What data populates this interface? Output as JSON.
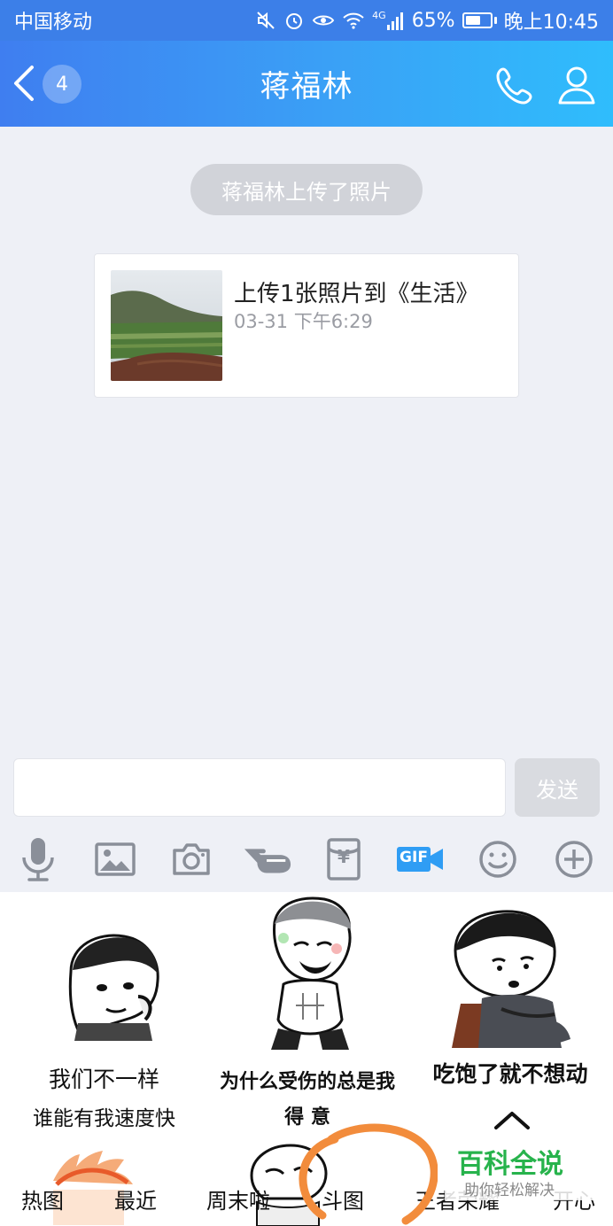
{
  "status_bar": {
    "carrier": "中国移动",
    "network": "4G",
    "battery": "65%",
    "battery_level": 0.65,
    "time": "晚上10:45"
  },
  "header": {
    "unread_count": "4",
    "title": "蒋福林"
  },
  "messages": {
    "system_notice": "蒋福林上传了照片",
    "card": {
      "title": "上传1张照片到《生活》",
      "time": "03-31 下午6:29"
    }
  },
  "composer": {
    "input_value": "",
    "send_label": "发送"
  },
  "toolbar": {
    "icons": [
      "microphone-icon",
      "image-icon",
      "camera-icon",
      "poke-icon",
      "red-packet-icon",
      "gif-icon",
      "emoji-icon",
      "plus-icon"
    ],
    "gif_label": "GIF",
    "red_packet_label": "¥"
  },
  "stickers": [
    {
      "caption_line1": "我们不一样",
      "caption_line2": "谁能有我速度快"
    },
    {
      "caption_line1": "为什么受伤的总是我",
      "caption_line2": "得 意"
    },
    {
      "caption_line1": "吃饱了就不想动",
      "caption_line2": ""
    }
  ],
  "sticker_tabs": [
    "热图",
    "最近",
    "周末啦",
    "斗图",
    "王者荣耀",
    "开心"
  ],
  "watermark": {
    "title": "百科全说",
    "subtitle": "助你轻松解决"
  },
  "colors": {
    "header_start": "#3f7ef0",
    "header_end": "#2fbdfc",
    "toolbar_icon": "#8a8f99",
    "gif_accent": "#2f9df4",
    "annotation": "#f28c3c",
    "watermark_green": "#27b34c"
  }
}
